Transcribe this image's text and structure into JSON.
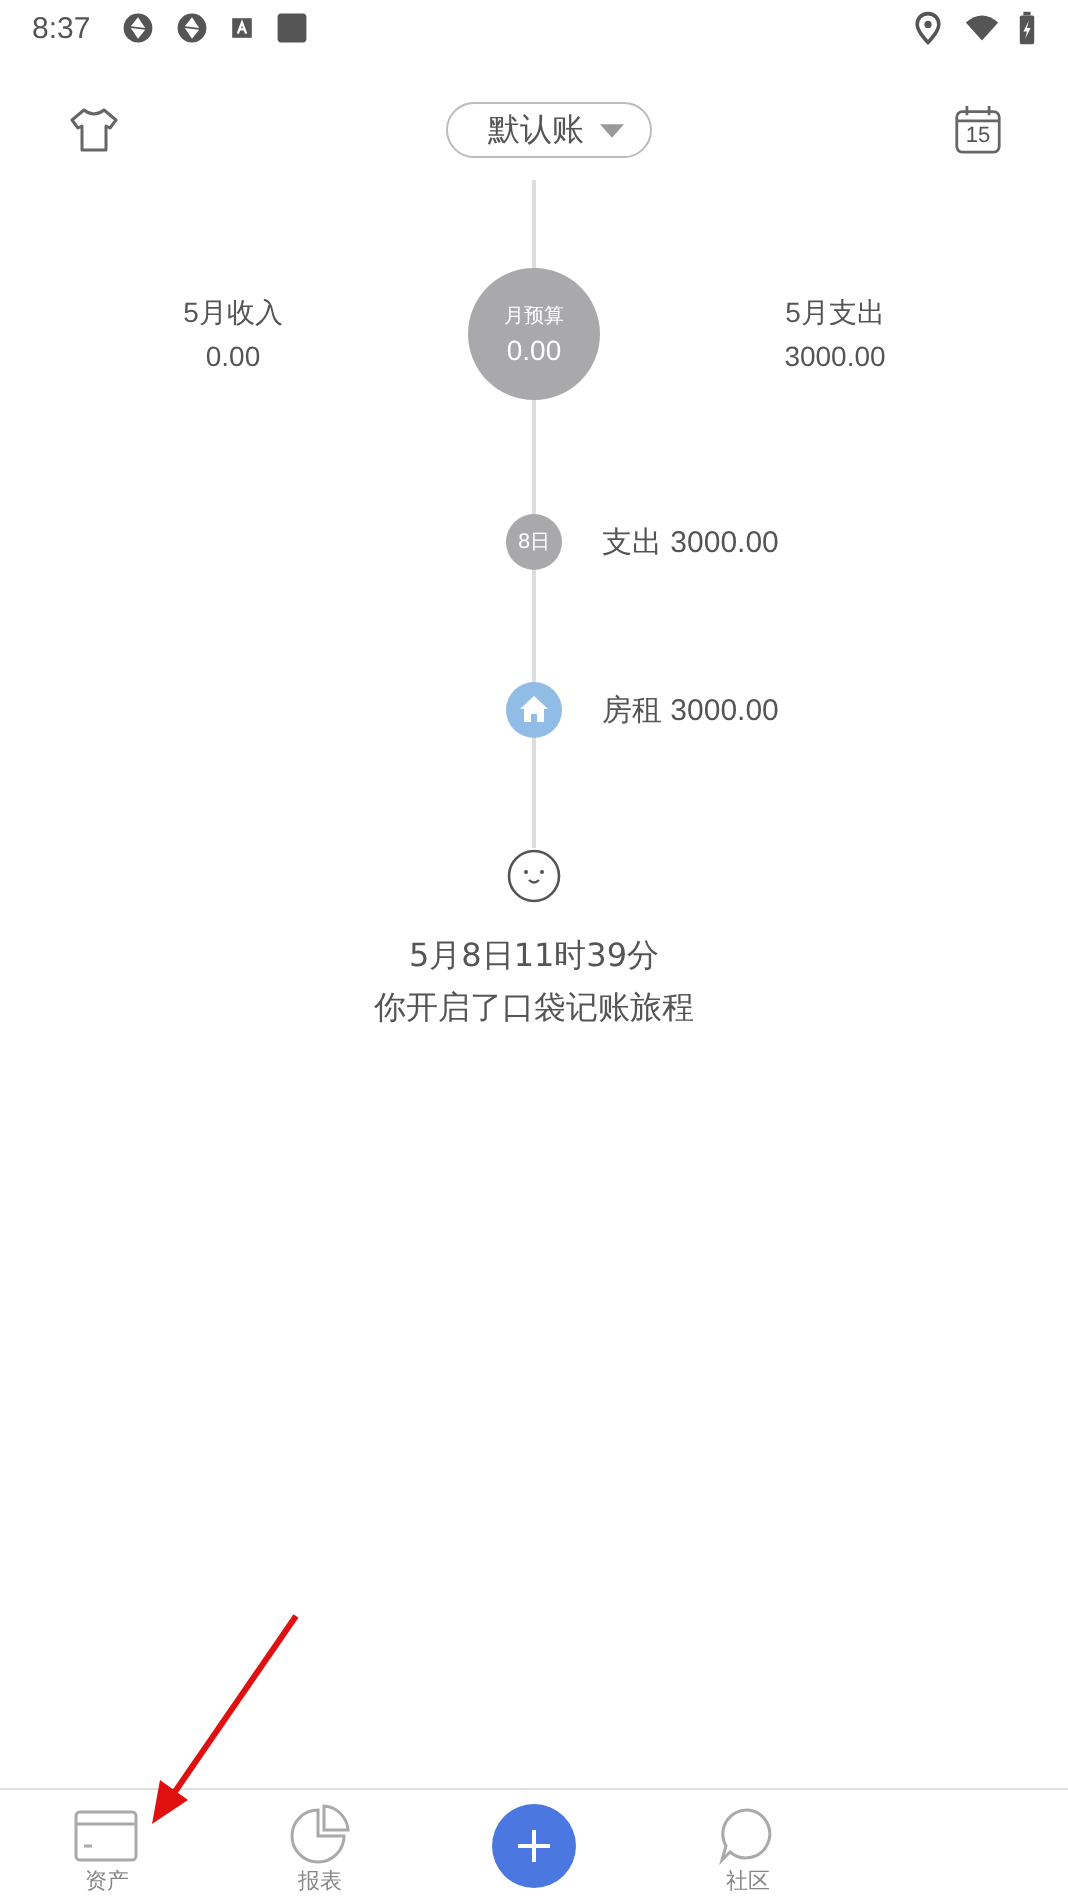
{
  "status_bar": {
    "time": "8:37"
  },
  "header": {
    "book_selector": "默认账",
    "calendar_day": "15"
  },
  "summary": {
    "income_label": "5月收入",
    "income": "0.00",
    "budget_label": "月预算",
    "budget": "0.00",
    "expense_label": "5月支出",
    "expense": "3000.00"
  },
  "timeline": [
    {
      "kind": "day",
      "badge": "8日",
      "text": "支出 3000.00"
    },
    {
      "kind": "house",
      "text": "房租 3000.00"
    }
  ],
  "start": {
    "time": "5月8日11时39分",
    "message": "你开启了口袋记账旅程"
  },
  "tab_bar": [
    {
      "kind": "assets",
      "label": "资产"
    },
    {
      "kind": "report",
      "label": "报表"
    },
    {
      "kind": "add"
    },
    {
      "kind": "community",
      "label": "社区"
    },
    {
      "kind": "blank"
    }
  ]
}
